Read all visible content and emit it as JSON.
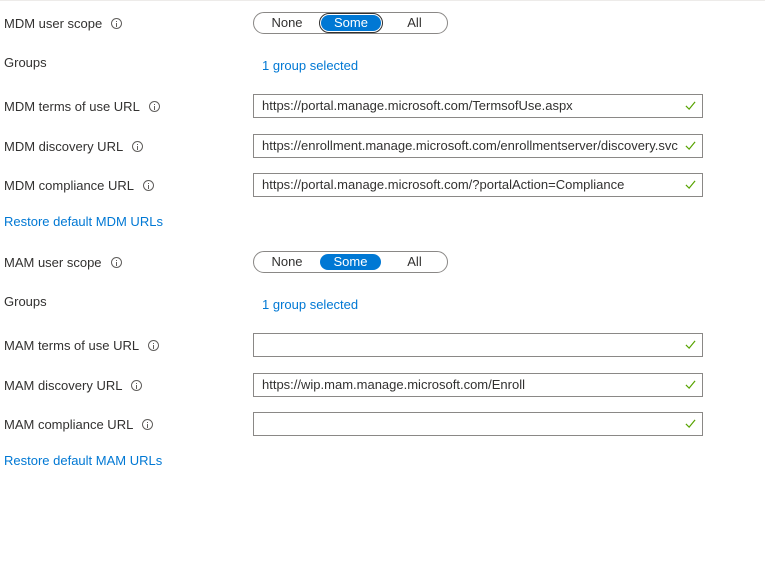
{
  "mdm": {
    "scope_label": "MDM user scope",
    "scope_options": [
      "None",
      "Some",
      "All"
    ],
    "scope_selected": "Some",
    "groups_label": "Groups",
    "groups_link": "1 group selected",
    "terms_label": "MDM terms of use URL",
    "terms_value": "https://portal.manage.microsoft.com/TermsofUse.aspx",
    "discovery_label": "MDM discovery URL",
    "discovery_value": "https://enrollment.manage.microsoft.com/enrollmentserver/discovery.svc",
    "compliance_label": "MDM compliance URL",
    "compliance_value": "https://portal.manage.microsoft.com/?portalAction=Compliance",
    "restore_link": "Restore default MDM URLs"
  },
  "mam": {
    "scope_label": "MAM user scope",
    "scope_options": [
      "None",
      "Some",
      "All"
    ],
    "scope_selected": "Some",
    "groups_label": "Groups",
    "groups_link": "1 group selected",
    "terms_label": "MAM terms of use URL",
    "terms_value": "",
    "discovery_label": "MAM discovery URL",
    "discovery_value": "https://wip.mam.manage.microsoft.com/Enroll",
    "compliance_label": "MAM compliance URL",
    "compliance_value": "",
    "restore_link": "Restore default MAM URLs"
  },
  "icons": {
    "info": "info-icon",
    "valid": "checkmark-icon"
  },
  "colors": {
    "accent": "#0078d4",
    "valid_check": "#57a300",
    "border": "#8a8886",
    "text": "#323130"
  }
}
